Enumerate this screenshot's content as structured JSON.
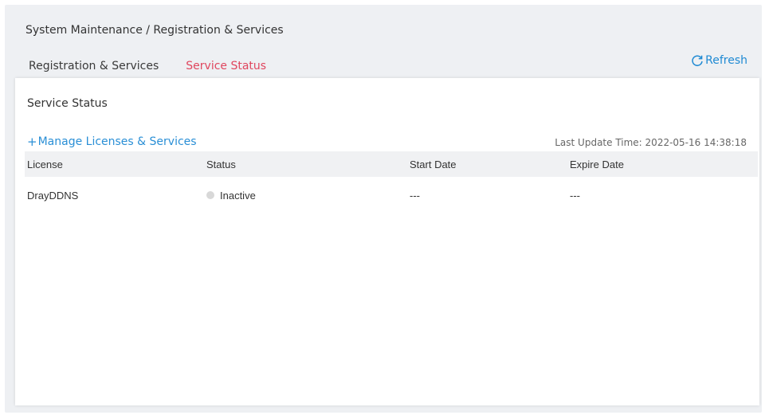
{
  "breadcrumb": "System Maintenance / Registration & Services",
  "tabs": [
    {
      "label": "Registration & Services",
      "active": false
    },
    {
      "label": "Service Status",
      "active": true
    }
  ],
  "refresh_label": "Refresh",
  "panel": {
    "title": "Service Status",
    "manage_link": "Manage Licenses & Services",
    "last_update": "Last Update Time: 2022-05-16 14:38:18",
    "columns": [
      "License",
      "Status",
      "Start Date",
      "Expire Date"
    ],
    "rows": [
      {
        "license": "DrayDDNS",
        "status": "Inactive",
        "start": "---",
        "expire": "---"
      }
    ]
  },
  "colors": {
    "accent": "#e0465e",
    "link": "#2a8fd6",
    "inactive_dot": "#d8d8d8"
  },
  "icons": {
    "refresh": "refresh-icon",
    "add": "plus-icon",
    "status": "status-dot-icon"
  }
}
